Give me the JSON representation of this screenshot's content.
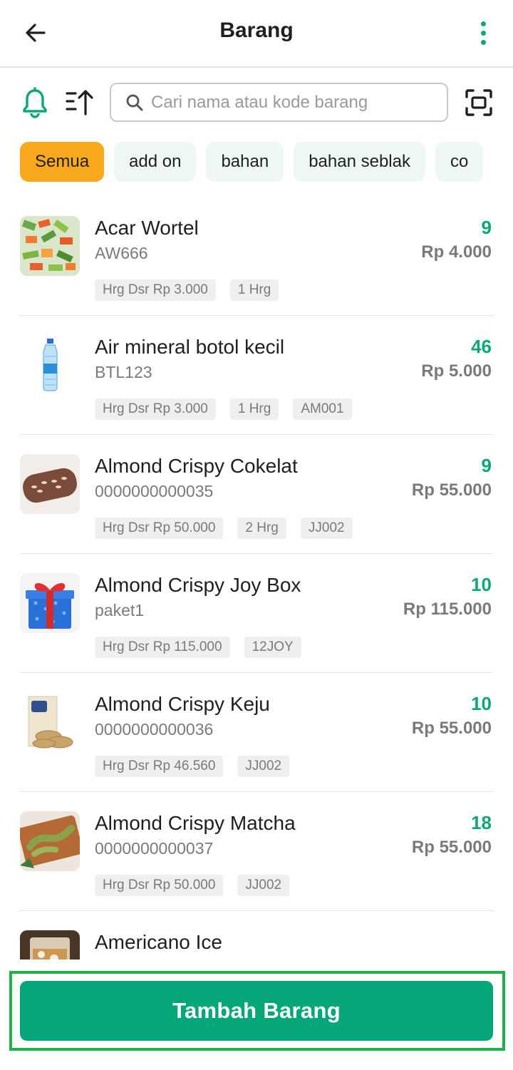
{
  "appbar": {
    "title": "Barang"
  },
  "search": {
    "placeholder": "Cari nama atau kode barang"
  },
  "chips": [
    "Semua",
    "add on",
    "bahan",
    "bahan seblak",
    "co"
  ],
  "items": [
    {
      "name": "Acar Wortel",
      "code": "AW666",
      "qty": "9",
      "price": "Rp 4.000",
      "tags": [
        "Hrg Dsr Rp 3.000",
        "1 Hrg"
      ]
    },
    {
      "name": "Air mineral botol kecil",
      "code": "BTL123",
      "qty": "46",
      "price": "Rp 5.000",
      "tags": [
        "Hrg Dsr Rp 3.000",
        "1 Hrg",
        "AM001"
      ]
    },
    {
      "name": "Almond Crispy Cokelat",
      "code": "0000000000035",
      "qty": "9",
      "price": "Rp 55.000",
      "tags": [
        "Hrg Dsr Rp 50.000",
        "2 Hrg",
        "JJ002"
      ]
    },
    {
      "name": "Almond Crispy Joy Box",
      "code": "paket1",
      "qty": "10",
      "price": "Rp 115.000",
      "tags": [
        "Hrg Dsr Rp 115.000",
        "12JOY"
      ]
    },
    {
      "name": "Almond Crispy Keju",
      "code": "0000000000036",
      "qty": "10",
      "price": "Rp 55.000",
      "tags": [
        "Hrg Dsr Rp 46.560",
        "JJ002"
      ]
    },
    {
      "name": "Almond Crispy Matcha",
      "code": "0000000000037",
      "qty": "18",
      "price": "Rp 55.000",
      "tags": [
        "Hrg Dsr Rp 50.000",
        "JJ002"
      ]
    },
    {
      "name": "Americano Ice",
      "code": "",
      "qty": "",
      "price": "",
      "tags": []
    }
  ],
  "footer": {
    "add_button": "Tambah Barang"
  },
  "colors": {
    "primary": "#05a677",
    "qty": "#0aa878",
    "chip_active": "#f9a91e",
    "chip": "#eef7f3",
    "frame": "#1fb24a"
  }
}
